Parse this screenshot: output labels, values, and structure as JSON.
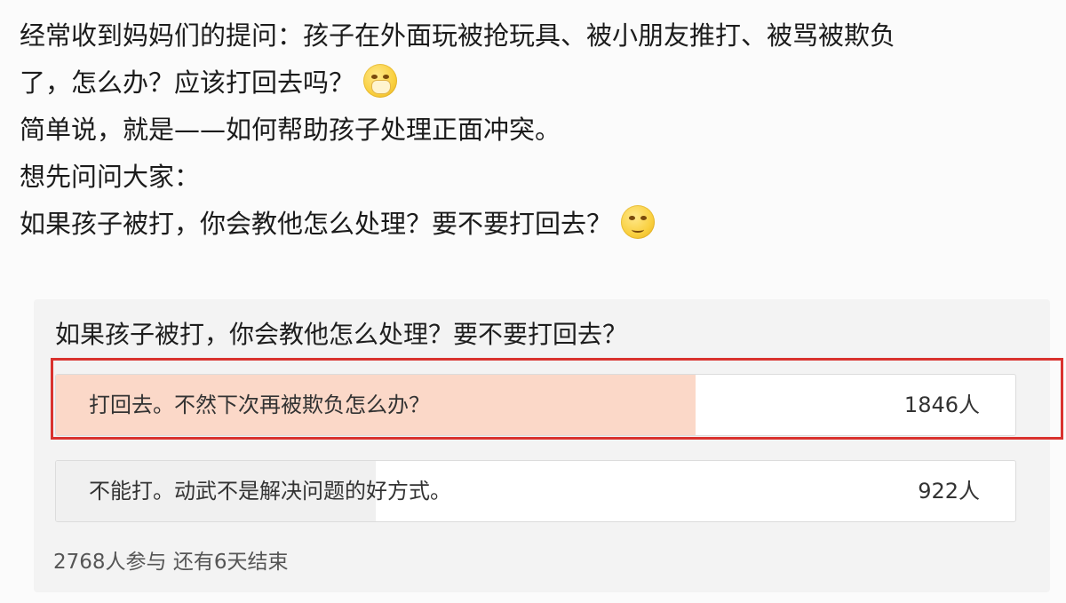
{
  "post": {
    "line1": "经常收到妈妈们的提问：孩子在外面玩被抢玩具、被小朋友推打、被骂被欺负",
    "line2": "了，怎么办？应该打回去吗？",
    "line3": "简单说，就是——如何帮助孩子处理正面冲突。",
    "line4": "想先问问大家：",
    "line5": "如果孩子被打，你会教他怎么处理？要不要打回去？",
    "emoji1_icon": "grin-hands-emoji-icon",
    "emoji2_icon": "thinking-emoji-icon"
  },
  "poll": {
    "question": "如果孩子被打，你会教他怎么处理？要不要打回去？",
    "options": [
      {
        "label": "打回去。不然下次再被欺负怎么办？",
        "count": "1846人",
        "share": 0.667,
        "fill_color": "#fbd8c8"
      },
      {
        "label": "不能打。动武不是解决问题的好方式。",
        "count": "922人",
        "share": 0.333,
        "fill_color": "#f0f0f0"
      }
    ],
    "footer": "2768人参与 还有6天结束",
    "highlight_color": "#d9322e"
  }
}
